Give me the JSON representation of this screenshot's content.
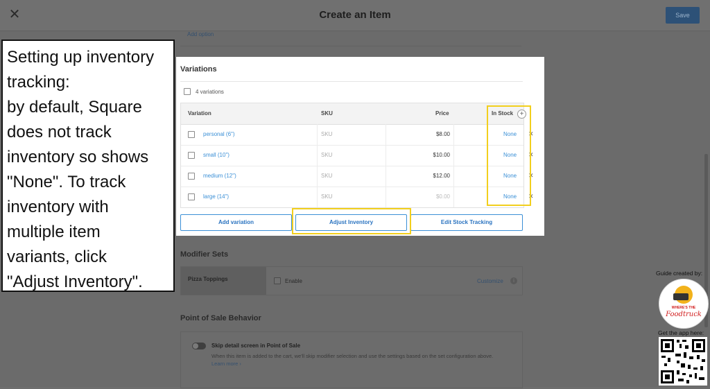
{
  "header": {
    "title": "Create an Item",
    "save_label": "Save",
    "close_glyph": "✕"
  },
  "background_form": {
    "add_option_label": "Add option"
  },
  "variations": {
    "heading": "Variations",
    "count_label": "4 variations",
    "columns": [
      "Variation",
      "SKU",
      "Price",
      "In Stock"
    ],
    "rows": [
      {
        "name": "personal (6\")",
        "sku": "SKU",
        "price": "$8.00",
        "stock": "None"
      },
      {
        "name": "small (10\")",
        "sku": "SKU",
        "price": "$10.00",
        "stock": "None"
      },
      {
        "name": "medium (12\")",
        "sku": "SKU",
        "price": "$12.00",
        "stock": "None"
      },
      {
        "name": "large (14\")",
        "sku": "SKU",
        "price": "$0.00",
        "stock": "None"
      }
    ],
    "add_variation_label": "Add variation",
    "adjust_inventory_label": "Adjust Inventory",
    "edit_stock_label": "Edit Stock Tracking",
    "add_column_glyph": "+",
    "remove_glyph": "✕"
  },
  "modifier_sets": {
    "title": "Modifier Sets",
    "name": "Pizza Toppings",
    "enable_label": "Enable",
    "customize_label": "Customize",
    "info_glyph": "i"
  },
  "pos_behavior": {
    "title": "Point of Sale Behavior",
    "toggle_label": "Skip detail screen in Point of Sale",
    "description": "When this item is added to the cart, we'll skip modifier selection and use the settings based on the set configuration above.",
    "learn_more": "Learn more ›"
  },
  "annotation": {
    "lines": [
      "Setting up inventory",
      "tracking:",
      "by default, Square",
      "does not track",
      "inventory so shows",
      "\"None\". To track",
      "inventory with",
      "multiple item",
      "variants, click",
      "\"Adjust Inventory\"."
    ]
  },
  "branding": {
    "guide_label": "Guide created by:",
    "logo_line1": "WHERE'S THE",
    "logo_line2": "Foodtruck",
    "app_label": "Get the app here:"
  },
  "colors": {
    "highlight": "#f2cf1d",
    "link": "#3a8fd6",
    "overlay": "#6b6b6b",
    "save_button": "#2d5177"
  },
  "icons": [
    "close-icon",
    "plus-circle-icon",
    "remove-icon",
    "info-icon",
    "qr-code-icon",
    "foodtruck-logo-icon"
  ]
}
